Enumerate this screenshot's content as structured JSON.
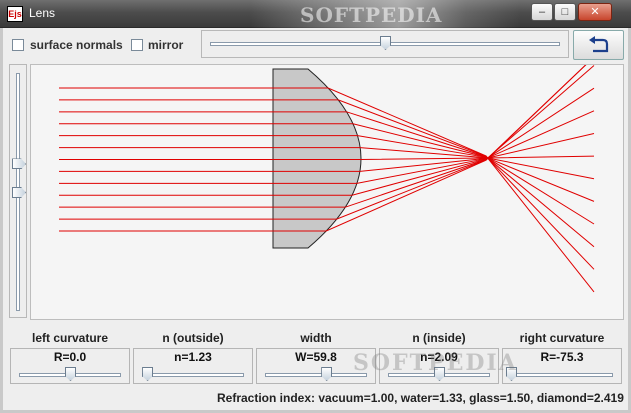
{
  "window": {
    "app_icon_text": "Ejs",
    "title": "Lens",
    "banner": "SOFTPEDIA",
    "minimize_glyph": "–",
    "maximize_glyph": "□",
    "close_glyph": "✕"
  },
  "toolbar": {
    "surface_normals_label": "surface normals",
    "surface_normals_checked": false,
    "mirror_label": "mirror",
    "mirror_checked": false,
    "main_slider_fraction": 0.5,
    "reset_icon": "reset-arrow-icon"
  },
  "vertical_slider": {
    "upper_thumb_fraction": 0.5,
    "lower_thumb_fraction": 0.38
  },
  "controls": [
    {
      "label": "left curvature",
      "value": "R=0.0",
      "slider_fraction": 0.5
    },
    {
      "label": "n (outside)",
      "value": "n=1.23",
      "slider_fraction": 0.05
    },
    {
      "label": "width",
      "value": "W=59.8",
      "slider_fraction": 0.6
    },
    {
      "label": "n (inside)",
      "value": "n=2.09",
      "slider_fraction": 0.5
    },
    {
      "label": "right curvature",
      "value": "R=-75.3",
      "slider_fraction": 0.0
    }
  ],
  "status": "Refraction index: vacuum=1.00, water=1.33, glass=1.50, diamond=2.419",
  "watermark": "SOFTPEDIA",
  "colors": {
    "ray": "#e00000",
    "lens_fill": "#c8c8c8",
    "lens_stroke": "#222222"
  },
  "rays": {
    "count": 13
  }
}
